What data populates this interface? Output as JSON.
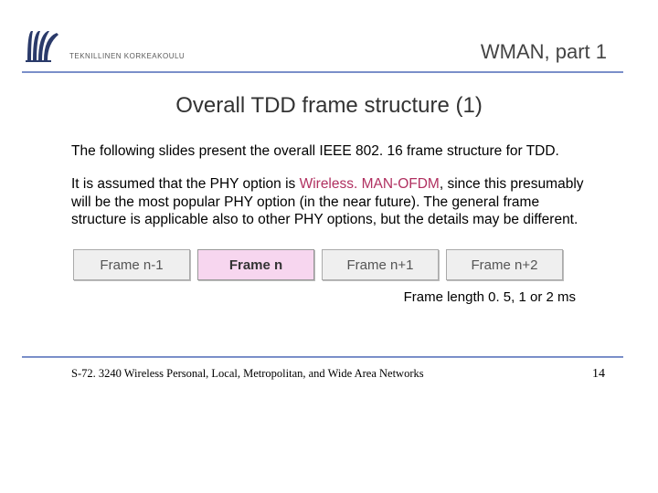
{
  "header": {
    "institution": "TEKNILLINEN KORKEAKOULU",
    "title": "WMAN, part 1"
  },
  "slide_title": "Overall TDD frame structure (1)",
  "body": {
    "p1": "The following slides present the overall IEEE 802. 16 frame structure for TDD.",
    "p2a": "It is assumed that the PHY option is ",
    "p2_hl": "Wireless. MAN-OFDM",
    "p2b": ", since this presumably will be the most popular PHY option (in the near future). The general frame structure is applicable also to other PHY options, but the details may be different."
  },
  "frames": {
    "items": [
      {
        "label": "Frame n-1",
        "current": false
      },
      {
        "label": "Frame n",
        "current": true
      },
      {
        "label": "Frame n+1",
        "current": false
      },
      {
        "label": "Frame n+2",
        "current": false
      }
    ],
    "length_note": "Frame length 0. 5, 1 or 2 ms"
  },
  "footer": {
    "course": "S-72. 3240 Wireless Personal, Local, Metropolitan, and Wide Area Networks",
    "page": "14"
  },
  "colors": {
    "rule": "#7a8fc9",
    "highlight": "#b03060",
    "frame_current_bg": "#f7d6ef"
  }
}
